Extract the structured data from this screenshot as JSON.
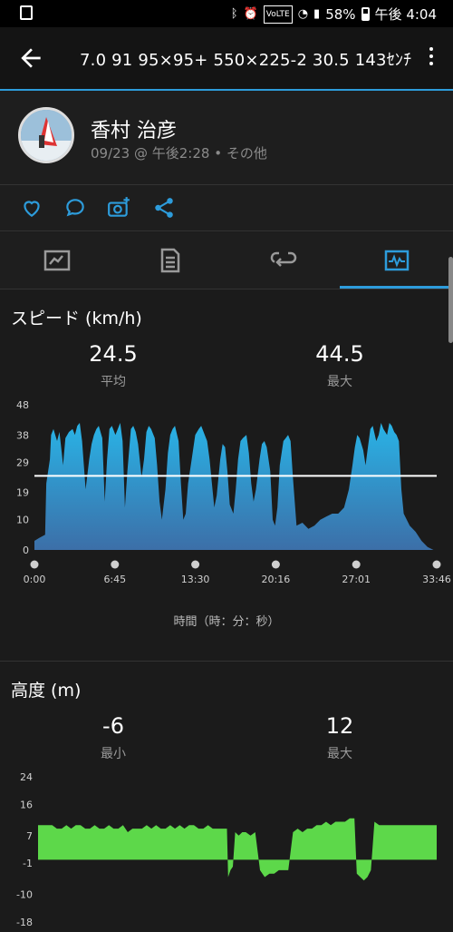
{
  "status_bar": {
    "battery": "58%",
    "time": "午後 4:04",
    "icons": [
      "bluetooth-icon",
      "alarm-icon",
      "volte-icon",
      "wifi-icon",
      "signal-icon",
      "battery-icon"
    ]
  },
  "header": {
    "title": "7.0  91  95×95+   550×225-2  30.5  143ｾﾝﾁ",
    "back_icon": "arrow-left-icon",
    "more_icon": "more-vertical-icon"
  },
  "activity": {
    "user_name": "香村 治彦",
    "meta": "09/23 @ 午後2:28 • その他"
  },
  "action_icons": [
    "heart-icon",
    "comment-icon",
    "add-photo-icon",
    "share-icon"
  ],
  "tabs": [
    {
      "icon": "map-icon",
      "active": false
    },
    {
      "icon": "details-icon",
      "active": false
    },
    {
      "icon": "laps-icon",
      "active": false
    },
    {
      "icon": "charts-icon",
      "active": true
    }
  ],
  "speed": {
    "title": "スピード (km/h)",
    "avg_value": "24.5",
    "avg_label": "平均",
    "max_value": "44.5",
    "max_label": "最大"
  },
  "elevation": {
    "title": "高度 (m)",
    "min_value": "-6",
    "min_label": "最小",
    "max_value": "12",
    "max_label": "最大"
  },
  "time_axis_caption": "時間（時：分：秒）",
  "colors": {
    "accent": "#2d9cdb",
    "speed_fill_top": "#29b3e6",
    "speed_fill_bottom": "#3c6fa8",
    "elevation_fill": "#5dd84a",
    "average_line": "#ffffff"
  },
  "chart_data": [
    {
      "type": "area",
      "title": "スピード (km/h)",
      "xlabel": "時間（時：分：秒）",
      "ylabel": "",
      "x_ticks": [
        "0:00",
        "6:45",
        "13:30",
        "20:16",
        "27:01",
        "33:46"
      ],
      "y_ticks": [
        0,
        10,
        19,
        29,
        38,
        48
      ],
      "ylim": [
        0,
        48
      ],
      "xlim_minutes": [
        0,
        33.77
      ],
      "average_line": 24.5,
      "x_minutes": [
        0,
        0.4,
        0.9,
        1.0,
        1.3,
        1.4,
        1.6,
        1.9,
        2.1,
        2.3,
        2.4,
        2.6,
        2.9,
        3.2,
        3.4,
        3.6,
        3.8,
        4.0,
        4.3,
        4.6,
        4.8,
        5.0,
        5.2,
        5.4,
        5.7,
        5.9,
        6.1,
        6.3,
        6.5,
        6.8,
        7.0,
        7.2,
        7.4,
        7.6,
        7.8,
        8.1,
        8.3,
        8.5,
        8.7,
        9.0,
        9.2,
        9.4,
        9.6,
        9.8,
        10.1,
        10.3,
        10.5,
        10.7,
        11.0,
        11.2,
        11.4,
        11.6,
        11.8,
        12.1,
        12.3,
        12.5,
        12.7,
        12.9,
        13.2,
        13.5,
        13.8,
        14.0,
        14.2,
        14.5,
        14.7,
        14.9,
        15.1,
        15.3,
        15.6,
        15.8,
        16.0,
        16.2,
        16.4,
        16.7,
        16.9,
        17.1,
        17.3,
        17.5,
        17.8,
        18.0,
        18.2,
        18.4,
        18.6,
        18.9,
        19.1,
        19.3,
        19.5,
        19.8,
        20.0,
        20.2,
        20.4,
        20.6,
        20.9,
        21.1,
        21.3,
        21.5,
        21.7,
        22.0,
        22.5,
        23.0,
        23.5,
        24.0,
        24.5,
        25.0,
        25.5,
        26.0,
        26.4,
        26.7,
        26.9,
        27.1,
        27.3,
        27.6,
        27.8,
        28.0,
        28.2,
        28.4,
        28.7,
        28.9,
        29.1,
        29.3,
        29.6,
        29.8,
        30.0,
        30.2,
        30.4,
        30.6,
        30.8,
        31.0,
        31.5,
        32.0,
        32.5,
        33.0,
        33.5,
        33.77
      ],
      "values": [
        3,
        4,
        5,
        22,
        30,
        38,
        40,
        36,
        39,
        32,
        28,
        37,
        39,
        40,
        38,
        41,
        42,
        36,
        20,
        30,
        35,
        38,
        40,
        41,
        37,
        16,
        30,
        40,
        41,
        38,
        40,
        42,
        36,
        14,
        26,
        40,
        41,
        39,
        35,
        24,
        30,
        39,
        41,
        40,
        37,
        28,
        16,
        10,
        20,
        32,
        38,
        40,
        41,
        36,
        22,
        10,
        12,
        22,
        30,
        38,
        40,
        41,
        39,
        36,
        30,
        22,
        14,
        18,
        30,
        35,
        34,
        26,
        15,
        12,
        20,
        30,
        36,
        37,
        38,
        32,
        22,
        16,
        20,
        30,
        35,
        36,
        34,
        26,
        10,
        8,
        14,
        28,
        36,
        37,
        38,
        36,
        24,
        8,
        9,
        7,
        8,
        10,
        11,
        12,
        12,
        14,
        20,
        28,
        34,
        38,
        37,
        33,
        28,
        34,
        40,
        41,
        36,
        38,
        42,
        40,
        38,
        42,
        41,
        39,
        38,
        36,
        20,
        12,
        8,
        6,
        3,
        1,
        0
      ]
    },
    {
      "type": "area",
      "title": "高度 (m)",
      "xlabel": "",
      "ylabel": "",
      "y_ticks": [
        24,
        16,
        7,
        -1,
        -10,
        -18
      ],
      "ylim": [
        -18,
        24
      ],
      "xlim_minutes": [
        0,
        33.77
      ],
      "x_minutes": [
        0,
        0.4,
        0.8,
        1.2,
        1.6,
        2.0,
        2.4,
        2.8,
        3.2,
        3.6,
        4.0,
        4.4,
        4.8,
        5.2,
        5.6,
        6.0,
        6.4,
        6.8,
        7.2,
        7.6,
        8.0,
        8.4,
        8.8,
        9.2,
        9.6,
        10.0,
        10.4,
        10.8,
        11.2,
        11.6,
        12.0,
        12.4,
        12.8,
        13.2,
        13.6,
        14.0,
        14.4,
        14.8,
        15.2,
        15.6,
        16.0,
        16.1,
        16.3,
        16.5,
        16.7,
        17.0,
        17.3,
        17.6,
        18.0,
        18.4,
        18.8,
        19.2,
        19.6,
        20.0,
        20.4,
        20.8,
        21.2,
        21.6,
        22.0,
        22.4,
        22.8,
        23.2,
        23.6,
        24.0,
        24.4,
        24.8,
        25.2,
        25.6,
        26.0,
        26.4,
        26.8,
        27.0,
        27.3,
        27.6,
        27.9,
        28.2,
        28.5,
        28.9,
        29.2,
        29.6,
        30.0,
        30.4,
        30.8,
        31.2,
        31.6,
        32.0,
        32.4,
        32.8,
        33.2,
        33.6,
        33.77
      ],
      "values": [
        10,
        10,
        10,
        10,
        9,
        9,
        10,
        9,
        10,
        10,
        9,
        9,
        10,
        9,
        9,
        10,
        9,
        9,
        10,
        8,
        9,
        9,
        9,
        10,
        9,
        10,
        9,
        9,
        10,
        9,
        10,
        9,
        10,
        10,
        9,
        9,
        10,
        9,
        9,
        9,
        9,
        -5,
        -3,
        -2,
        8,
        7,
        8,
        8,
        7,
        8,
        -3,
        -5,
        -4,
        -4,
        -3,
        -3,
        -3,
        8,
        9,
        8,
        9,
        9,
        10,
        10,
        11,
        10,
        11,
        11,
        11,
        12,
        12,
        -4,
        -5,
        -6,
        -5,
        -3,
        11,
        10,
        10,
        10,
        10,
        10,
        10,
        10,
        10,
        10,
        10,
        10,
        10,
        10,
        10
      ]
    }
  ]
}
